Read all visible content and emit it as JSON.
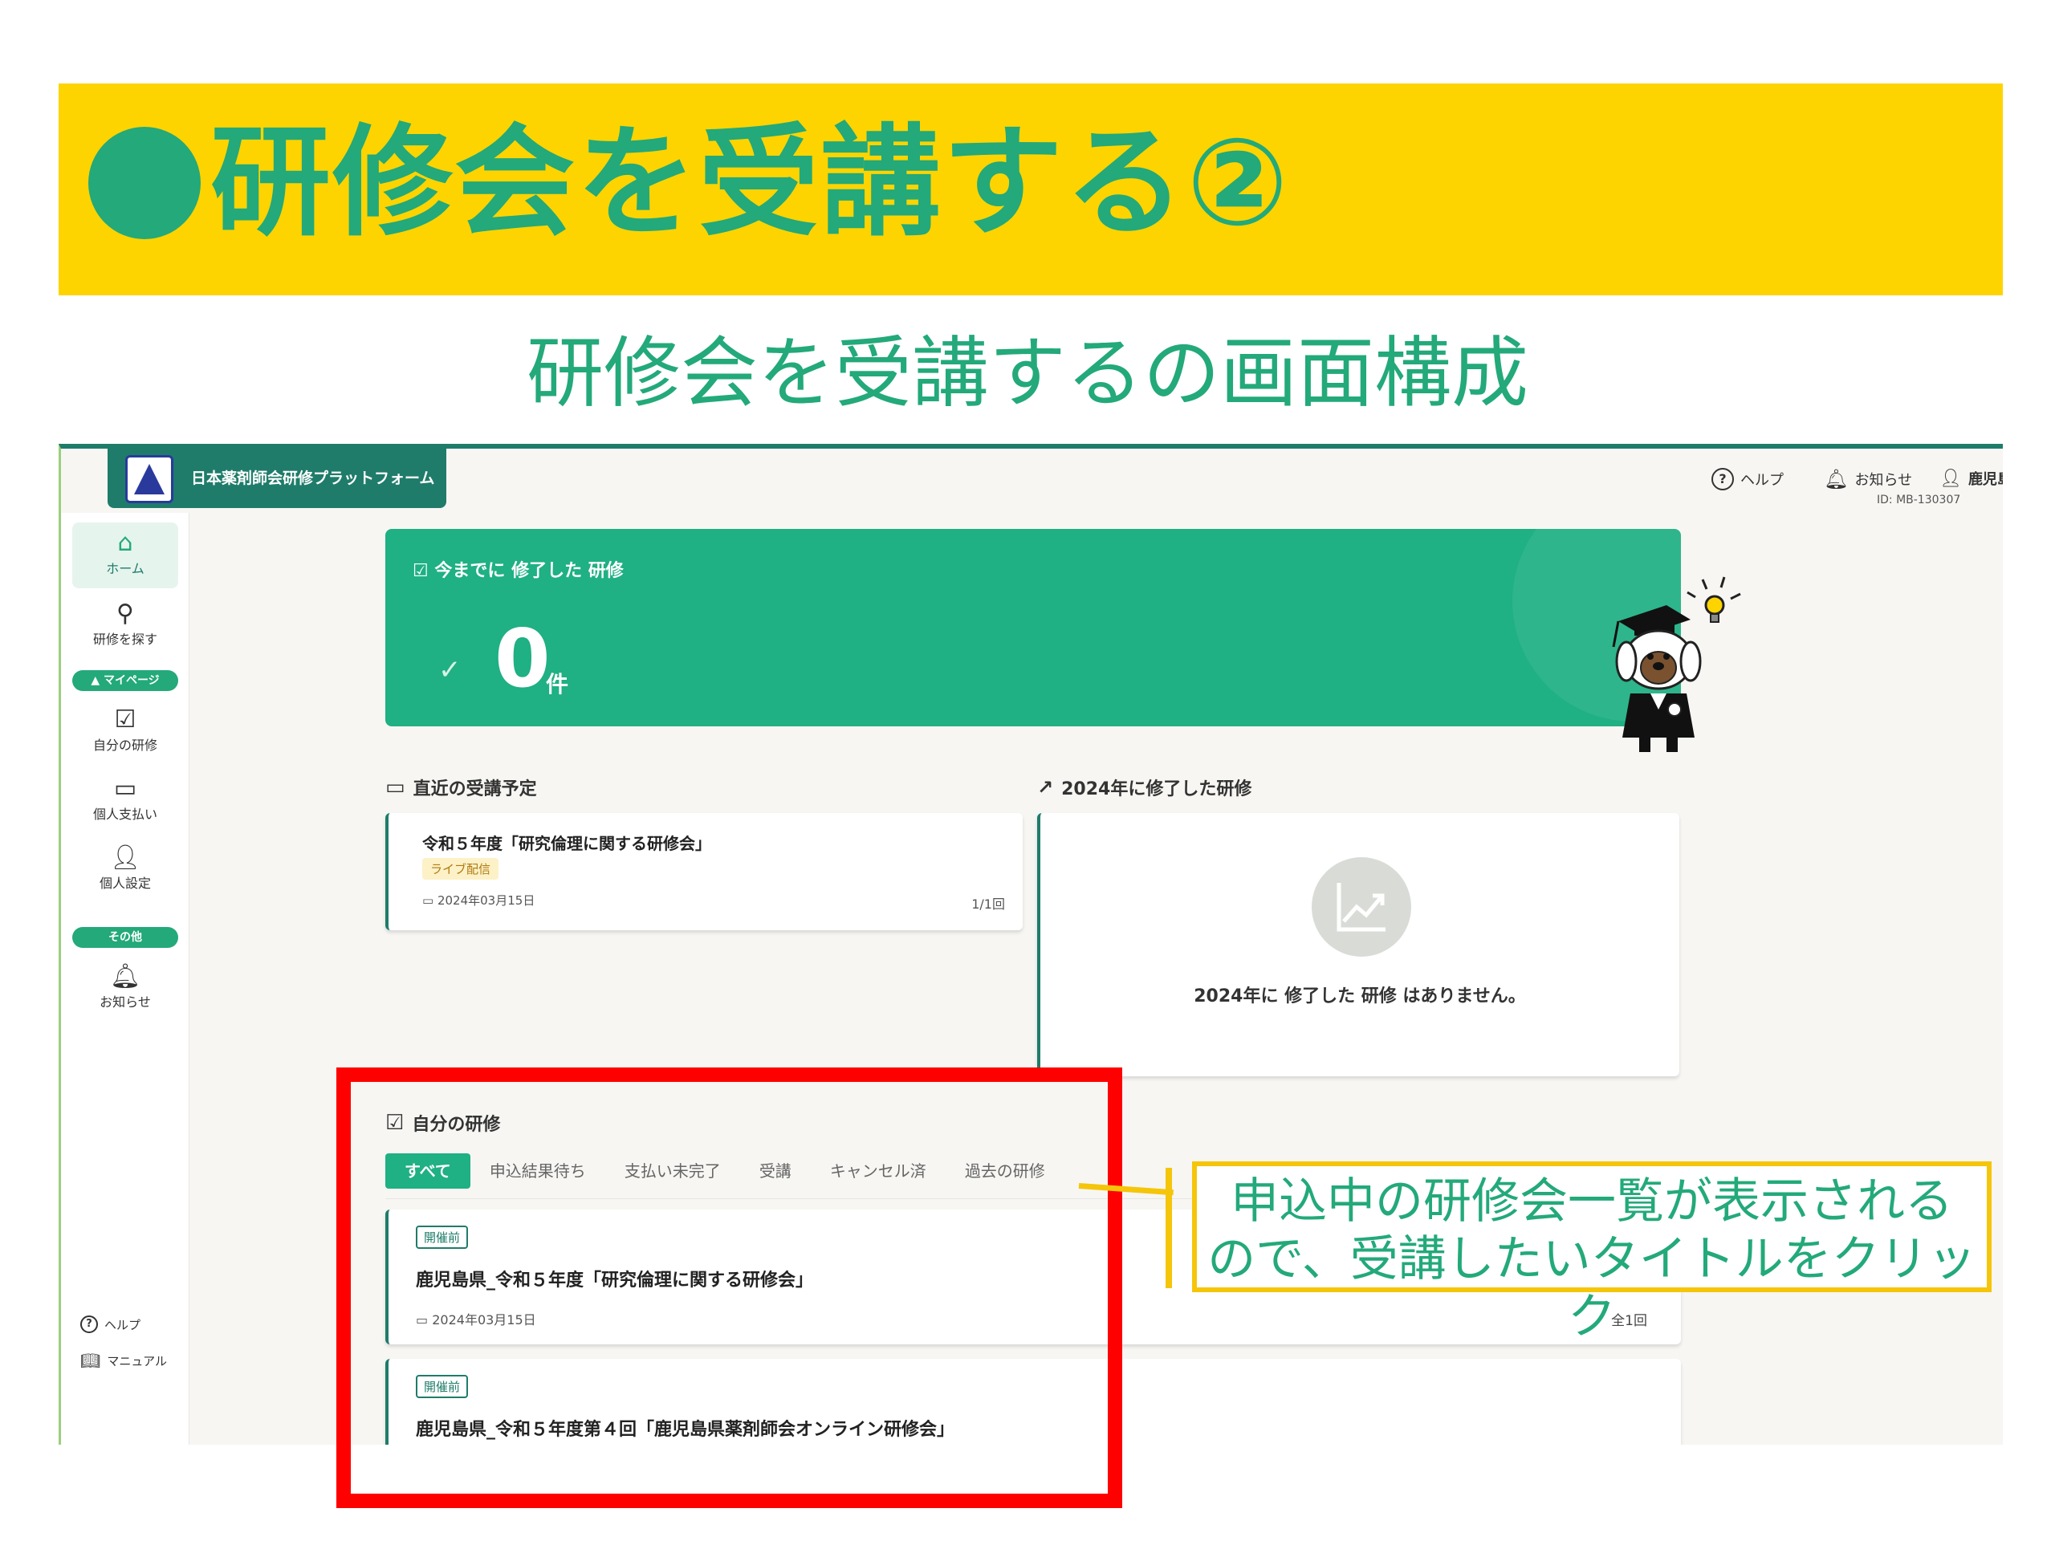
{
  "slide": {
    "title": "研修会を受講する②",
    "subtitle": "研修会を受講するの画面構成",
    "callout": {
      "line1": "申込中の研修会一覧が表示される",
      "line2": "ので、受講したいタイトルをクリック"
    }
  },
  "app": {
    "brand": "日本薬剤師会研修プラットフォーム",
    "topnav": {
      "help": "ヘルプ",
      "notice": "お知らせ",
      "user_name": "鹿児島 太郎",
      "user_id": "ID: MB-130307"
    },
    "sidebar": {
      "home": "ホーム",
      "search": "研修を探す",
      "mypage_pill": "▲ マイページ",
      "my_training": "自分の研修",
      "payment": "個人支払い",
      "settings": "個人設定",
      "other_pill": "その他",
      "notice": "お知らせ",
      "help": "ヘルプ",
      "manual": "マニュアル"
    },
    "hero": {
      "title": "今までに 修了した 研修",
      "count": "0",
      "unit": "件"
    },
    "schedule": {
      "title": "直近の受講予定",
      "card": {
        "title": "令和５年度「研究倫理に関する研修会」",
        "badge": "ライブ配信",
        "date": "2024年03月15日",
        "count": "1/1回"
      }
    },
    "completed": {
      "title": "2024年に修了した研修",
      "empty": "2024年に 修了した 研修 はありません。"
    },
    "my_trainings": {
      "title": "自分の研修",
      "tabs": [
        "すべて",
        "申込結果待ち",
        "支払い未完了",
        "受講",
        "キャンセル済",
        "過去の研修"
      ],
      "items": [
        {
          "badge": "開催前",
          "title": "鹿児島県_令和５年度「研究倫理に関する研修会」",
          "date": "2024年03月15日",
          "count": "全1回"
        },
        {
          "badge": "開催前",
          "title": "鹿児島県_令和５年度第４回「鹿児島県薬剤師会オンライン研修会」"
        }
      ]
    }
  },
  "colors": {
    "brand_green": "#23a97a",
    "dark_green": "#1f7c6a",
    "title_band_yellow": "#fdd400",
    "highlight_red": "#ff0000",
    "callout_yellow": "#f5c50a"
  }
}
